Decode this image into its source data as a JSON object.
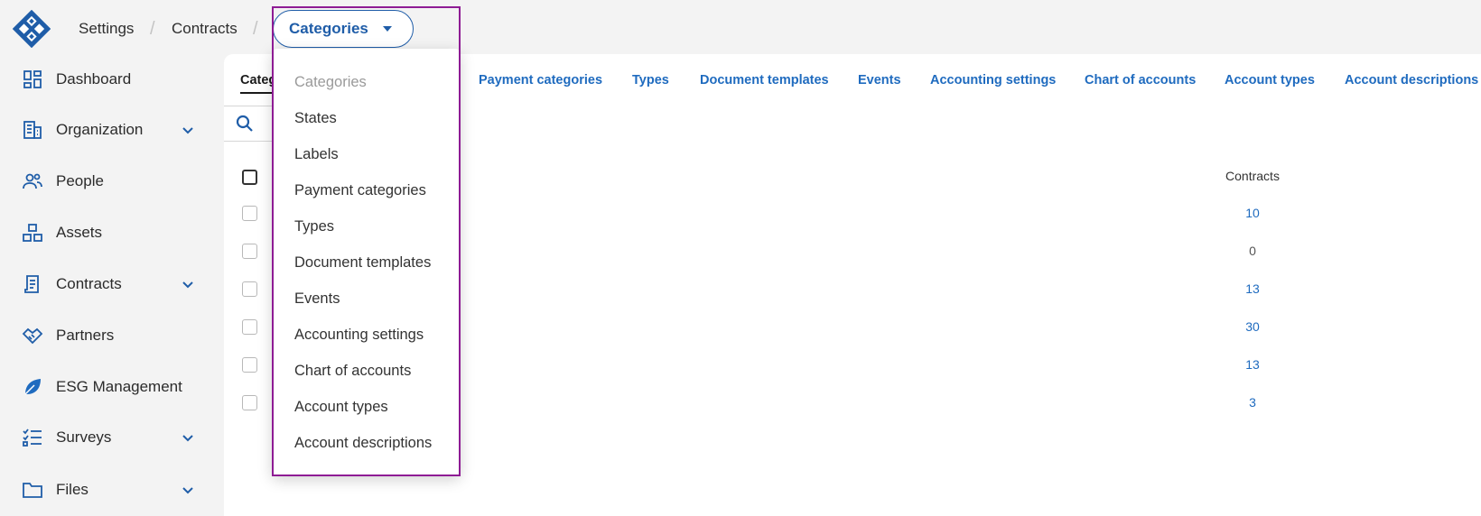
{
  "breadcrumb": {
    "items": [
      "Settings",
      "Contracts"
    ],
    "separator": "/",
    "current": "Categories"
  },
  "sidebar": {
    "items": [
      {
        "label": "Dashboard",
        "icon": "dashboard-icon",
        "expandable": false
      },
      {
        "label": "Organization",
        "icon": "building-icon",
        "expandable": true
      },
      {
        "label": "People",
        "icon": "people-icon",
        "expandable": false
      },
      {
        "label": "Assets",
        "icon": "assets-icon",
        "expandable": false
      },
      {
        "label": "Contracts",
        "icon": "contract-icon",
        "expandable": true
      },
      {
        "label": "Partners",
        "icon": "handshake-icon",
        "expandable": false
      },
      {
        "label": "ESG Management",
        "icon": "leaf-icon",
        "expandable": false
      },
      {
        "label": "Surveys",
        "icon": "checklist-icon",
        "expandable": true
      },
      {
        "label": "Files",
        "icon": "folder-icon",
        "expandable": true
      }
    ]
  },
  "tabs": {
    "active": "Categ",
    "items": [
      "Payment categories",
      "Types",
      "Document templates",
      "Events",
      "Accounting settings",
      "Chart of accounts",
      "Account types",
      "Account descriptions"
    ]
  },
  "table": {
    "column_header": "Contracts",
    "counts": [
      "10",
      "0",
      "13",
      "30",
      "13",
      "3"
    ]
  },
  "dropdown": {
    "items": [
      "Categories",
      "States",
      "Labels",
      "Payment categories",
      "Types",
      "Document templates",
      "Events",
      "Accounting settings",
      "Chart of accounts",
      "Account types",
      "Account descriptions"
    ],
    "disabled_index": 0
  },
  "colors": {
    "accent": "#1f5da8",
    "link": "#1f6bbf",
    "highlight": "#8e1c94"
  }
}
